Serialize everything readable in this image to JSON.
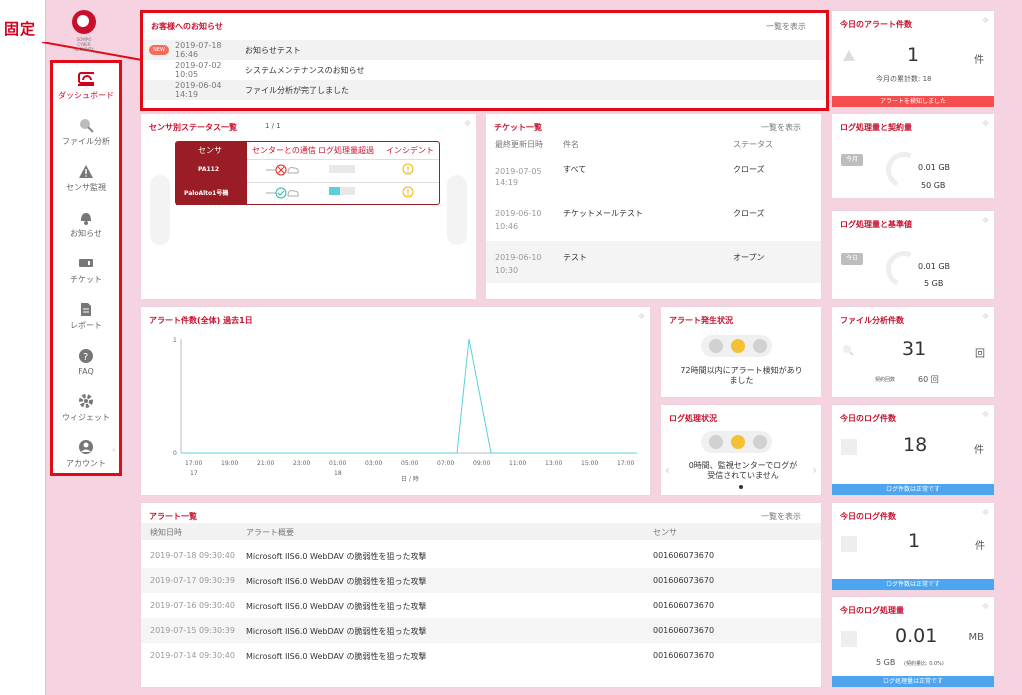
{
  "fixed_label": "固定",
  "sidebar": {
    "items": [
      {
        "label": "ダッシュボード",
        "icon": "dashboard-icon",
        "active": true
      },
      {
        "label": "ファイル分析",
        "icon": "search-icon",
        "active": false
      },
      {
        "label": "センサ監視",
        "icon": "warning-icon",
        "active": false
      },
      {
        "label": "お知らせ",
        "icon": "bell-icon",
        "active": false
      },
      {
        "label": "チケット",
        "icon": "ticket-icon",
        "active": false
      },
      {
        "label": "レポート",
        "icon": "document-icon",
        "active": false
      },
      {
        "label": "FAQ",
        "icon": "question-icon",
        "active": false
      },
      {
        "label": "ウィジェット",
        "icon": "gear-icon",
        "active": false
      },
      {
        "label": "アカウント",
        "icon": "user-icon",
        "active": false
      }
    ]
  },
  "notices": {
    "title": "お客様へのお知らせ",
    "link": "一覧を表示",
    "badge": "NEW",
    "items": [
      {
        "date": "2019-07-18 16:46",
        "text": "お知らせテスト"
      },
      {
        "date": "2019-07-02 10:05",
        "text": "システムメンテナンスのお知らせ"
      },
      {
        "date": "2019-06-04 14:19",
        "text": "ファイル分析が完了しました"
      }
    ]
  },
  "sensor_status": {
    "title": "センサ別ステータス一覧",
    "page": "1 / 1",
    "headers": [
      "センサ",
      "センターとの通信",
      "ログ処理量超過",
      "インシデント"
    ],
    "rows": [
      {
        "name": "PA112"
      },
      {
        "name": "PaloAlto1号機"
      }
    ]
  },
  "tickets": {
    "title": "チケット一覧",
    "link": "一覧を表示",
    "headers": [
      "最終更新日時",
      "件名",
      "ステータス"
    ],
    "rows": [
      {
        "date": "2019-07-05",
        "time": "14:19",
        "subject": "すべて",
        "status": "クローズ"
      },
      {
        "date": "2019-06-10",
        "time": "10:46",
        "subject": "チケットメールテスト",
        "status": "クローズ"
      },
      {
        "date": "2019-06-10",
        "time": "10:30",
        "subject": "テスト",
        "status": "オープン"
      }
    ]
  },
  "today_alerts": {
    "title": "今日のアラート件数",
    "count": "1",
    "unit": "件",
    "sub": "今月の累計数: 18",
    "bar": "アラートを検知しました",
    "bar_color": "#f64e4e"
  },
  "log_contract": {
    "title": "ログ処理量と契約量",
    "tag": "今月",
    "value": "0.01 GB",
    "limit": "50 GB"
  },
  "log_base": {
    "title": "ログ処理量と基準値",
    "tag": "今日",
    "value": "0.01 GB",
    "limit": "5 GB"
  },
  "alert_chart": {
    "title": "アラート件数(全体) 過去1日"
  },
  "chart_data": {
    "type": "line",
    "title": "アラート件数(全体) 過去1日",
    "xlabel": "日 / 時",
    "ylabel": "",
    "x": [
      "17:00",
      "19:00",
      "21:00",
      "23:00",
      "01:00",
      "03:00",
      "05:00",
      "07:00",
      "09:00",
      "11:00",
      "13:00",
      "15:00",
      "17:00"
    ],
    "x_day_labels": [
      "17",
      "18"
    ],
    "series": [
      {
        "values": [
          0,
          0,
          0,
          0,
          0,
          0,
          0,
          0,
          1,
          0,
          0,
          0,
          0
        ]
      }
    ],
    "peak_time": "08:30",
    "ylim": [
      0,
      1
    ],
    "yticks": [
      "0",
      "1"
    ],
    "color": "#5ccfd8"
  },
  "alert_status": {
    "title": "アラート発生状況",
    "message": "72時間以内にアラート検知がありました",
    "lights": [
      "#d1d1d1",
      "#f5c033",
      "#d1d1d1"
    ]
  },
  "log_status": {
    "title": "ログ処理状況",
    "message": "0時間、監視センターでログが受信されていません",
    "lights": [
      "#d1d1d1",
      "#f5c033",
      "#d1d1d1"
    ]
  },
  "file_analysis": {
    "title": "ファイル分析件数",
    "count": "31",
    "unit": "回",
    "sub_label": "契約回数",
    "sub_value": "60 回"
  },
  "today_logs": {
    "title": "今日のログ件数",
    "count": "18",
    "unit": "件",
    "bar": "ログ件数は正常です",
    "bar_color": "#4da4ef"
  },
  "today_logs2": {
    "title": "今日のログ件数",
    "count": "1",
    "unit": "件",
    "bar": "ログ件数は正常です"
  },
  "today_log_volume": {
    "title": "今日のログ処理量",
    "count": "0.01",
    "unit": "MB",
    "sub": "5 GB",
    "sub_small": "(契約量比: 0.0%)",
    "bar": "ログ処理量は正常です"
  },
  "alerts": {
    "title": "アラート一覧",
    "link": "一覧を表示",
    "headers": [
      "検知日時",
      "アラート概要",
      "センサ"
    ],
    "rows": [
      {
        "date": "2019-07-18 09:30:40",
        "summary": "Microsoft IIS6.0 WebDAV の脆弱性を狙った攻撃",
        "sensor": "001606073670"
      },
      {
        "date": "2019-07-17 09:30:39",
        "summary": "Microsoft IIS6.0 WebDAV の脆弱性を狙った攻撃",
        "sensor": "001606073670"
      },
      {
        "date": "2019-07-16 09:30:40",
        "summary": "Microsoft IIS6.0 WebDAV の脆弱性を狙った攻撃",
        "sensor": "001606073670"
      },
      {
        "date": "2019-07-15 09:30:39",
        "summary": "Microsoft IIS6.0 WebDAV の脆弱性を狙った攻撃",
        "sensor": "001606073670"
      },
      {
        "date": "2019-07-14 09:30:40",
        "summary": "Microsoft IIS6.0 WebDAV の脆弱性を狙った攻撃",
        "sensor": "001606073670"
      }
    ]
  }
}
